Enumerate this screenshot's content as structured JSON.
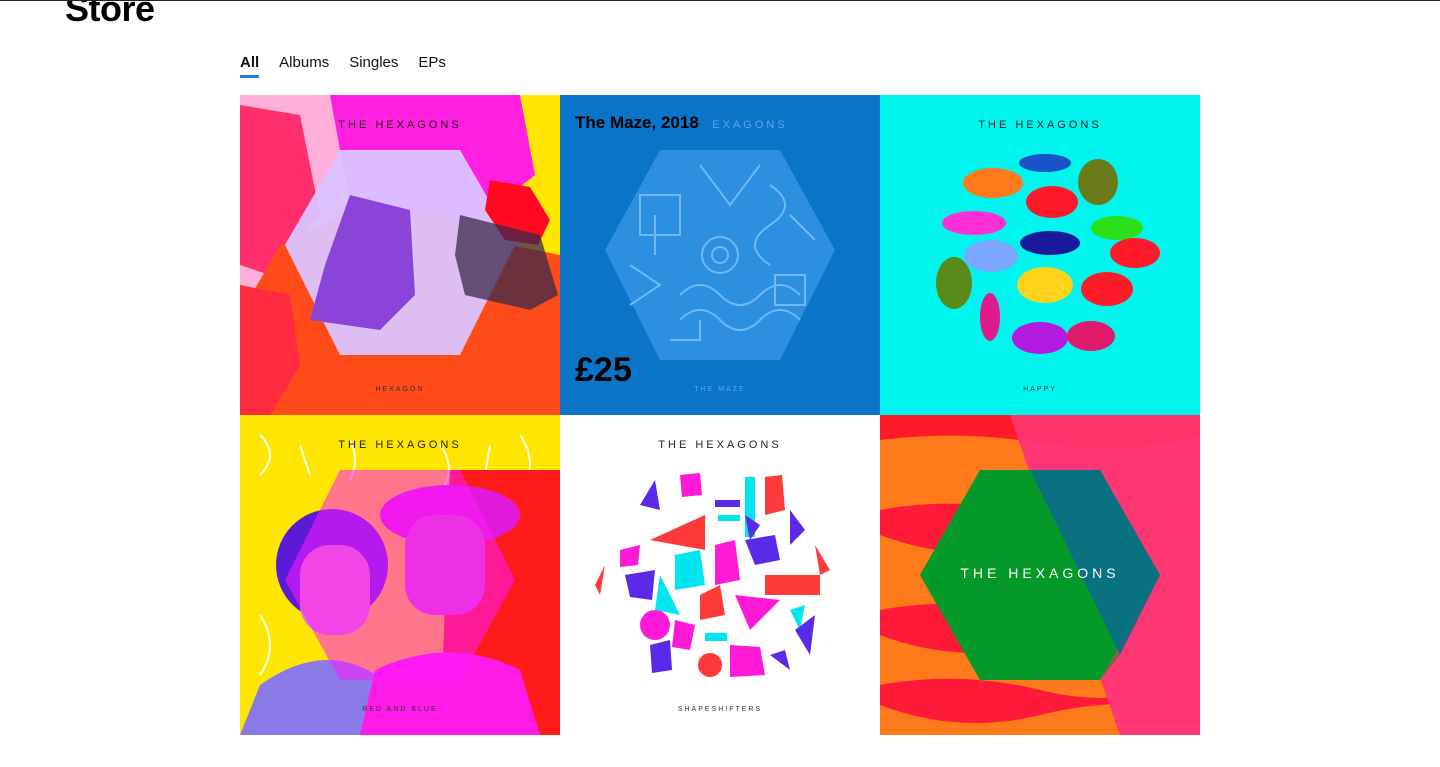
{
  "page": {
    "title": "Store"
  },
  "tabs": [
    {
      "label": "All",
      "active": true
    },
    {
      "label": "Albums",
      "active": false
    },
    {
      "label": "Singles",
      "active": false
    },
    {
      "label": "EPs",
      "active": false
    }
  ],
  "colors": {
    "accent": "#1b7fe0"
  },
  "albums": [
    {
      "band": "THE HEXAGONS",
      "subtitle": "HEXAGON",
      "bg": "#ffb0da"
    },
    {
      "band": "EXAGONS",
      "subtitle": "THE MAZE",
      "bg": "#0a74c9",
      "hover_title": "The Maze, 2018",
      "hover_price": "£25"
    },
    {
      "band": "THE HEXAGONS",
      "subtitle": "HAPPY",
      "bg": "#00f5ee"
    },
    {
      "band": "THE HEXAGONS",
      "subtitle": "RED AND BLUE",
      "bg": "#ffe600"
    },
    {
      "band": "THE HEXAGONS",
      "subtitle": "SHAPESHIFTERS",
      "bg": "#ffffff"
    },
    {
      "band": "THE HEXAGONS",
      "bg": "#ff1f3f"
    }
  ]
}
